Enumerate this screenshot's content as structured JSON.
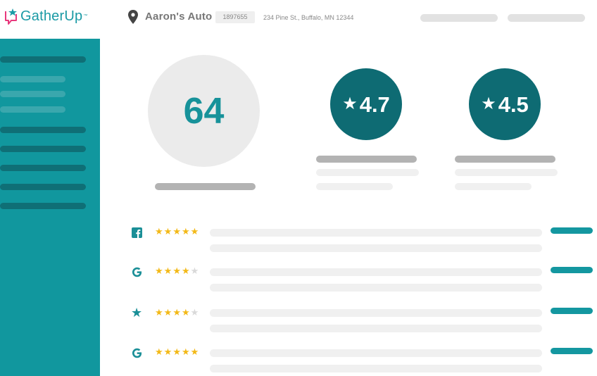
{
  "brand": {
    "name": "GatherUp",
    "tm": "™",
    "icon": "speech-bubble-star-logo",
    "color": "#1a9aa5"
  },
  "header": {
    "pin_icon": "map-pin-icon",
    "location_name": "Aaron's Auto",
    "location_id": "1897655",
    "address": "234 Pine St., Buffalo, MN 12344"
  },
  "metrics": {
    "score": "64",
    "ratings": [
      {
        "value": "4.7",
        "icon": "star-icon"
      },
      {
        "value": "4.5",
        "icon": "star-icon"
      }
    ]
  },
  "reviews": [
    {
      "source": "facebook-icon",
      "stars": 5
    },
    {
      "source": "google-icon",
      "stars": 4
    },
    {
      "source": "star-icon",
      "stars": 4
    },
    {
      "source": "google-icon",
      "stars": 5
    }
  ],
  "colors": {
    "sidebar": "#11979e",
    "rating_circle": "#0e6b73",
    "score_text": "#17929a",
    "star": "#f3b918"
  }
}
